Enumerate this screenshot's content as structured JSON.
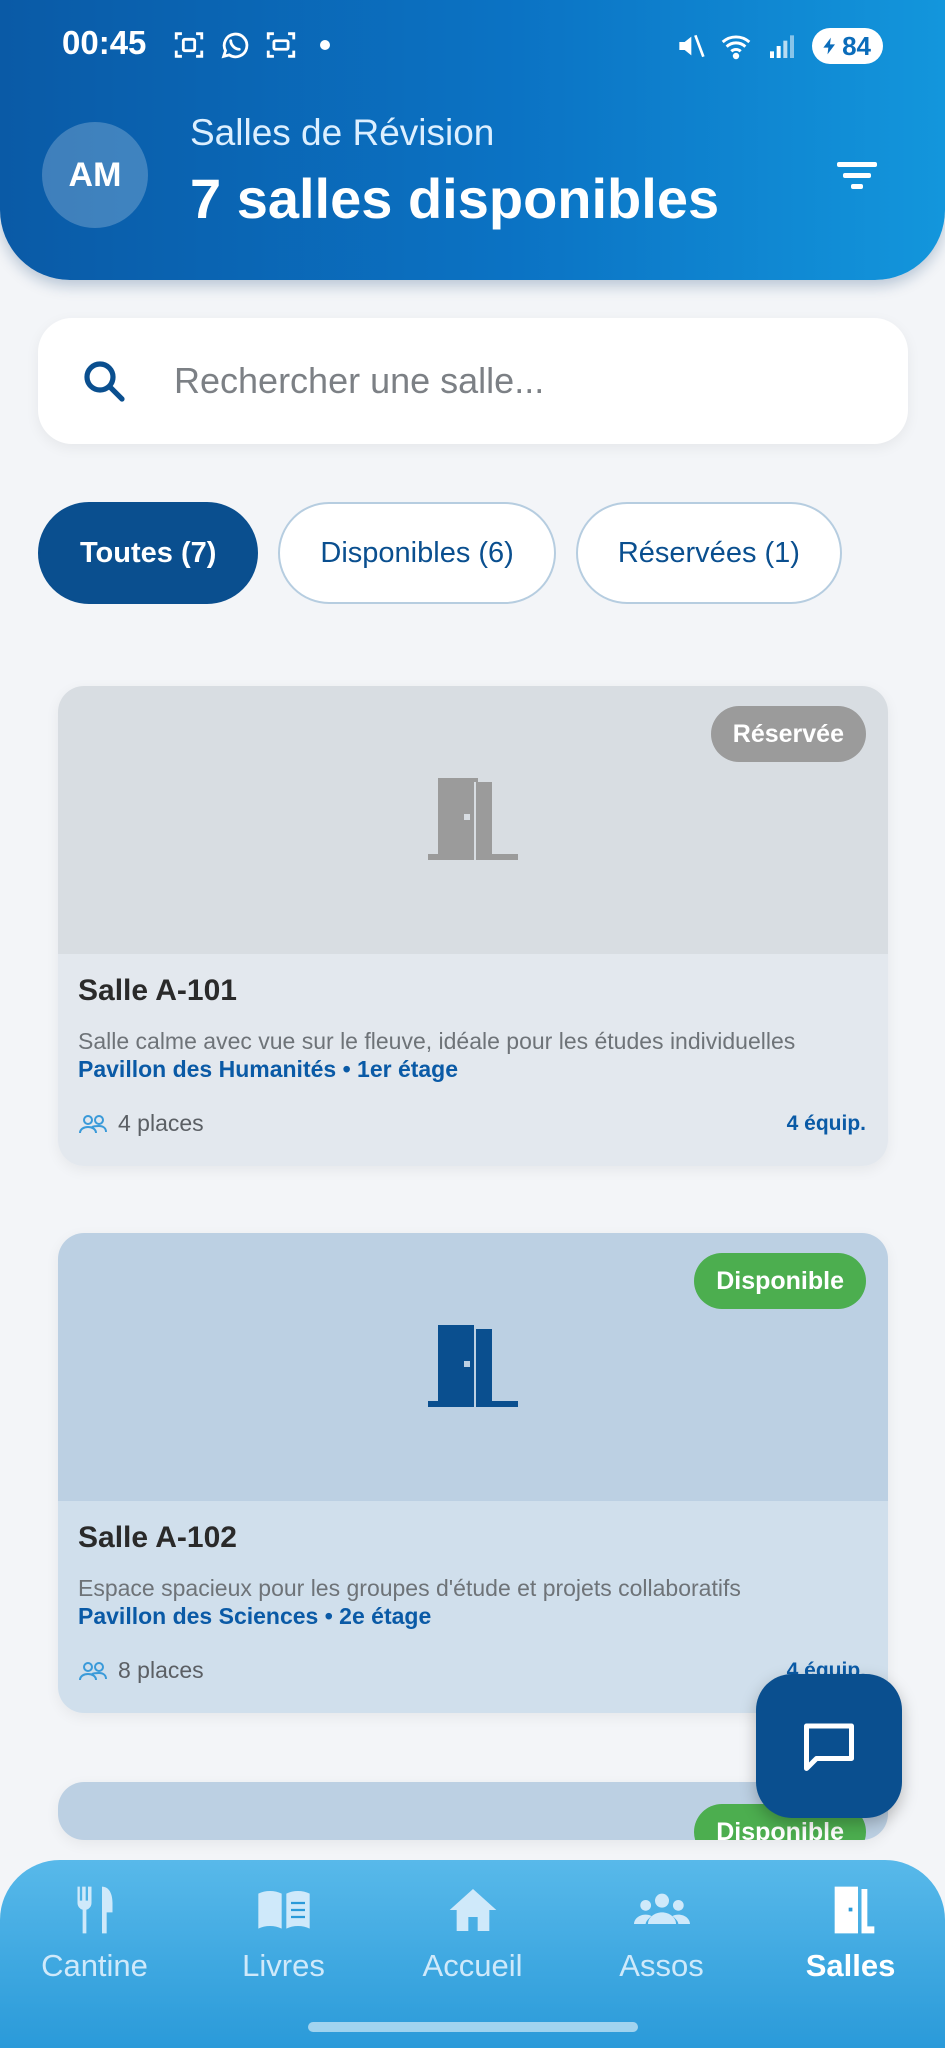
{
  "status_bar": {
    "time": "00:45",
    "battery": "84",
    "icons_left": [
      "screenshot-icon",
      "whatsapp-icon",
      "screen-capture-icon"
    ],
    "icons_right": [
      "mute-icon",
      "wifi-icon",
      "signal-icon",
      "battery-icon"
    ]
  },
  "header": {
    "avatar_initials": "AM",
    "subtitle": "Salles de Révision",
    "title": "7 salles disponibles",
    "filter_icon": "filter-icon"
  },
  "search": {
    "placeholder": "Rechercher une salle...",
    "value": "",
    "icon": "search-icon"
  },
  "tabs": [
    {
      "label": "Toutes (7)",
      "active": true
    },
    {
      "label": "Disponibles (6)",
      "active": false
    },
    {
      "label": "Réservées (1)",
      "active": false
    }
  ],
  "rooms": [
    {
      "name": "Salle A-101",
      "status": "Réservée",
      "description": "Salle calme avec vue sur le fleuve, idéale pour les études individuelles",
      "location": "Pavillon des Humanités • 1er étage",
      "capacity": "4 places",
      "equipment": "4 équip."
    },
    {
      "name": "Salle A-102",
      "status": "Disponible",
      "description": "Espace spacieux pour les groupes d'étude et projets collaboratifs",
      "location": "Pavillon des Sciences • 2e étage",
      "capacity": "8 places",
      "equipment": "4 équip."
    },
    {
      "status": "Disponible"
    }
  ],
  "colors": {
    "primary": "#0a4f8f",
    "available": "#4cae4f",
    "reserved": "#9b9b9b",
    "nav_bg": "#2a9ad9"
  },
  "bottom_nav": [
    {
      "label": "Cantine",
      "icon": "fork-knife-icon",
      "active": false
    },
    {
      "label": "Livres",
      "icon": "book-icon",
      "active": false
    },
    {
      "label": "Accueil",
      "icon": "home-icon",
      "active": false
    },
    {
      "label": "Assos",
      "icon": "group-icon",
      "active": false
    },
    {
      "label": "Salles",
      "icon": "door-icon",
      "active": true
    }
  ]
}
